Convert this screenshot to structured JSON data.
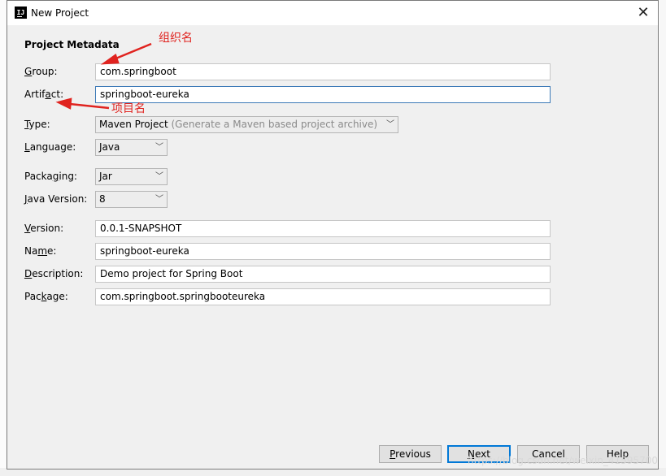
{
  "window": {
    "title": "New Project",
    "app_icon_text": "IJ"
  },
  "section_title": "Project Metadata",
  "fields": {
    "group": {
      "label_ul": "G",
      "label_rest": "roup:",
      "value": "com.springboot"
    },
    "artifact": {
      "label_pre": "Artif",
      "label_ul": "a",
      "label_post": "ct:",
      "value": "springboot-eureka"
    },
    "type": {
      "label_ul": "T",
      "label_rest": "ype:",
      "value": "Maven Project",
      "hint": "(Generate a Maven based project archive)"
    },
    "language": {
      "label_ul": "L",
      "label_rest": "anguage:",
      "value": "Java"
    },
    "packaging": {
      "label_pre": "Packa",
      "label_ul": "g",
      "label_post": "ing:",
      "value": "Jar"
    },
    "java_version": {
      "label_ul": "J",
      "label_rest": "ava Version:",
      "value": "8"
    },
    "version": {
      "label_ul": "V",
      "label_rest": "ersion:",
      "value": "0.0.1-SNAPSHOT"
    },
    "name": {
      "label_pre": "Na",
      "label_ul": "m",
      "label_post": "e:",
      "value": "springboot-eureka"
    },
    "description": {
      "label_ul": "D",
      "label_rest": "escription:",
      "value": "Demo project for Spring Boot"
    },
    "package": {
      "label_pre": "Pac",
      "label_ul": "k",
      "label_post": "age:",
      "value": "com.springboot.springbooteureka"
    }
  },
  "buttons": {
    "previous": {
      "ul": "P",
      "rest": "revious"
    },
    "next": {
      "ul": "N",
      "rest": "ext"
    },
    "cancel": "Cancel",
    "help": "Help"
  },
  "annotations": {
    "group_note": "组织名",
    "artifact_note": "项目名"
  },
  "watermark": "https://blog.csdn.net/weixin_41595700",
  "colors": {
    "annotation_red": "#e0231f",
    "focus_blue": "#3d7ab7",
    "default_button_blue": "#0078d7"
  }
}
